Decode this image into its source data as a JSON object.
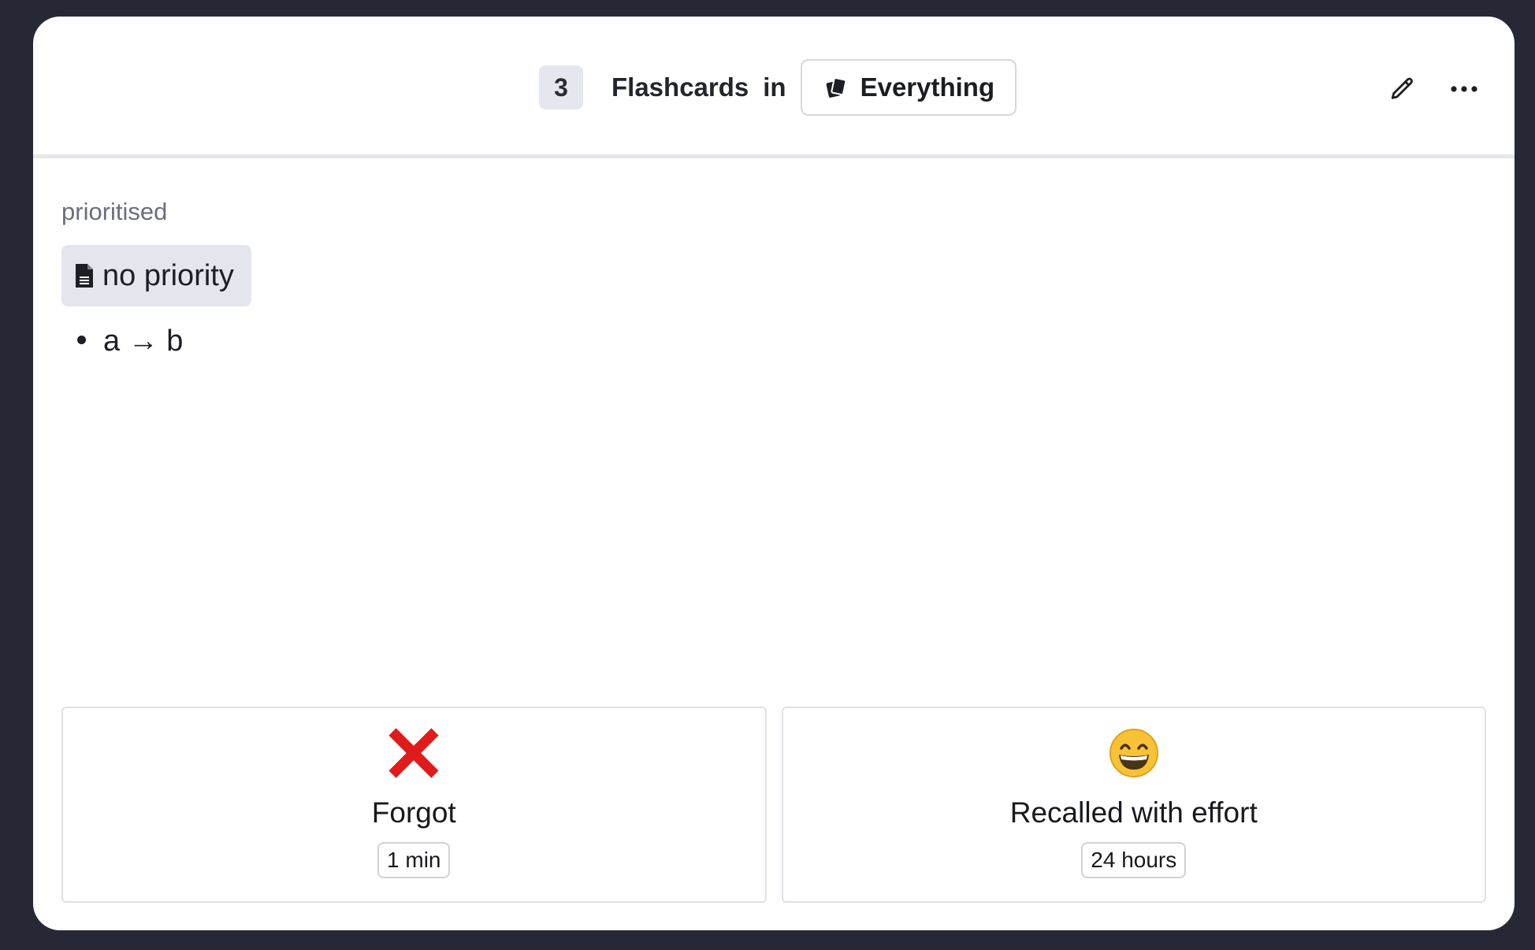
{
  "header": {
    "count": "3",
    "title_label": "Flashcards",
    "in_label": "in",
    "deck_name": "Everything",
    "deck_icon": "cards-icon",
    "actions": [
      {
        "name": "edit",
        "icon": "pencil-icon"
      },
      {
        "name": "more",
        "icon": "more-horizontal-icon"
      }
    ]
  },
  "card": {
    "status_label": "prioritised",
    "document": {
      "icon": "document-icon",
      "label": "no priority"
    },
    "bullet": "a → b"
  },
  "answers": [
    {
      "icon": "red-cross-icon",
      "label": "Forgot",
      "interval": "1 min",
      "icon_color": "#e01b1b"
    },
    {
      "icon": "grinning-face-icon",
      "label": "Recalled with effort",
      "interval": "24 hours",
      "icon_color": "#f7c235"
    }
  ]
}
